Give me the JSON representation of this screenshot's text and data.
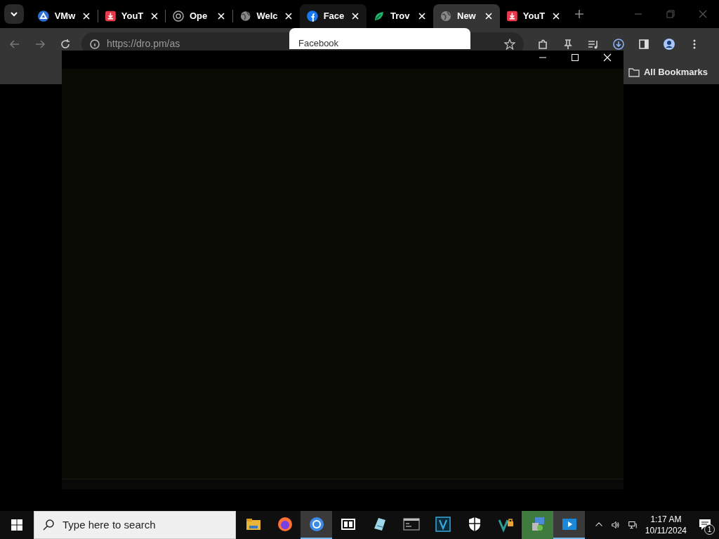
{
  "browser": {
    "tabs": [
      {
        "title": "VMw",
        "kind": "triangle",
        "selected": false,
        "hovered": false
      },
      {
        "title": "YouT",
        "kind": "download",
        "selected": false,
        "hovered": false
      },
      {
        "title": "Ope",
        "kind": "knot",
        "selected": false,
        "hovered": false
      },
      {
        "title": "Welc",
        "kind": "globe",
        "selected": false,
        "hovered": false
      },
      {
        "title": "Face",
        "kind": "f",
        "selected": false,
        "hovered": true
      },
      {
        "title": "Trov",
        "kind": "leaf",
        "selected": false,
        "hovered": false
      },
      {
        "title": "New",
        "kind": "globe",
        "selected": true,
        "hovered": false
      },
      {
        "title": "YouT",
        "kind": "download",
        "selected": false,
        "hovered": false
      }
    ],
    "address": "https://dro.pm/as",
    "tooltip": "Facebook",
    "bookmarks_folder": "All Bookmarks"
  },
  "taskbar": {
    "search": {
      "placeholder": "Type here to search"
    },
    "apps": [
      {
        "kind": "folder",
        "selected": false,
        "flashing": false
      },
      {
        "kind": "fox",
        "selected": false,
        "flashing": false
      },
      {
        "kind": "ring",
        "selected": true,
        "flashing": false
      },
      {
        "kind": "archive",
        "selected": false,
        "flashing": false
      },
      {
        "kind": "notepad",
        "selected": false,
        "flashing": false
      },
      {
        "kind": "terminal",
        "selected": false,
        "flashing": false
      },
      {
        "kind": "editor",
        "selected": false,
        "flashing": false
      },
      {
        "kind": "shield",
        "selected": false,
        "flashing": false
      },
      {
        "kind": "lock",
        "selected": false,
        "flashing": false
      },
      {
        "kind": "installer",
        "selected": false,
        "flashing": true
      },
      {
        "kind": "player",
        "selected": true,
        "flashing": false
      }
    ],
    "time": "1:17 AM",
    "date": "10/11/2024",
    "notifications": "1"
  }
}
